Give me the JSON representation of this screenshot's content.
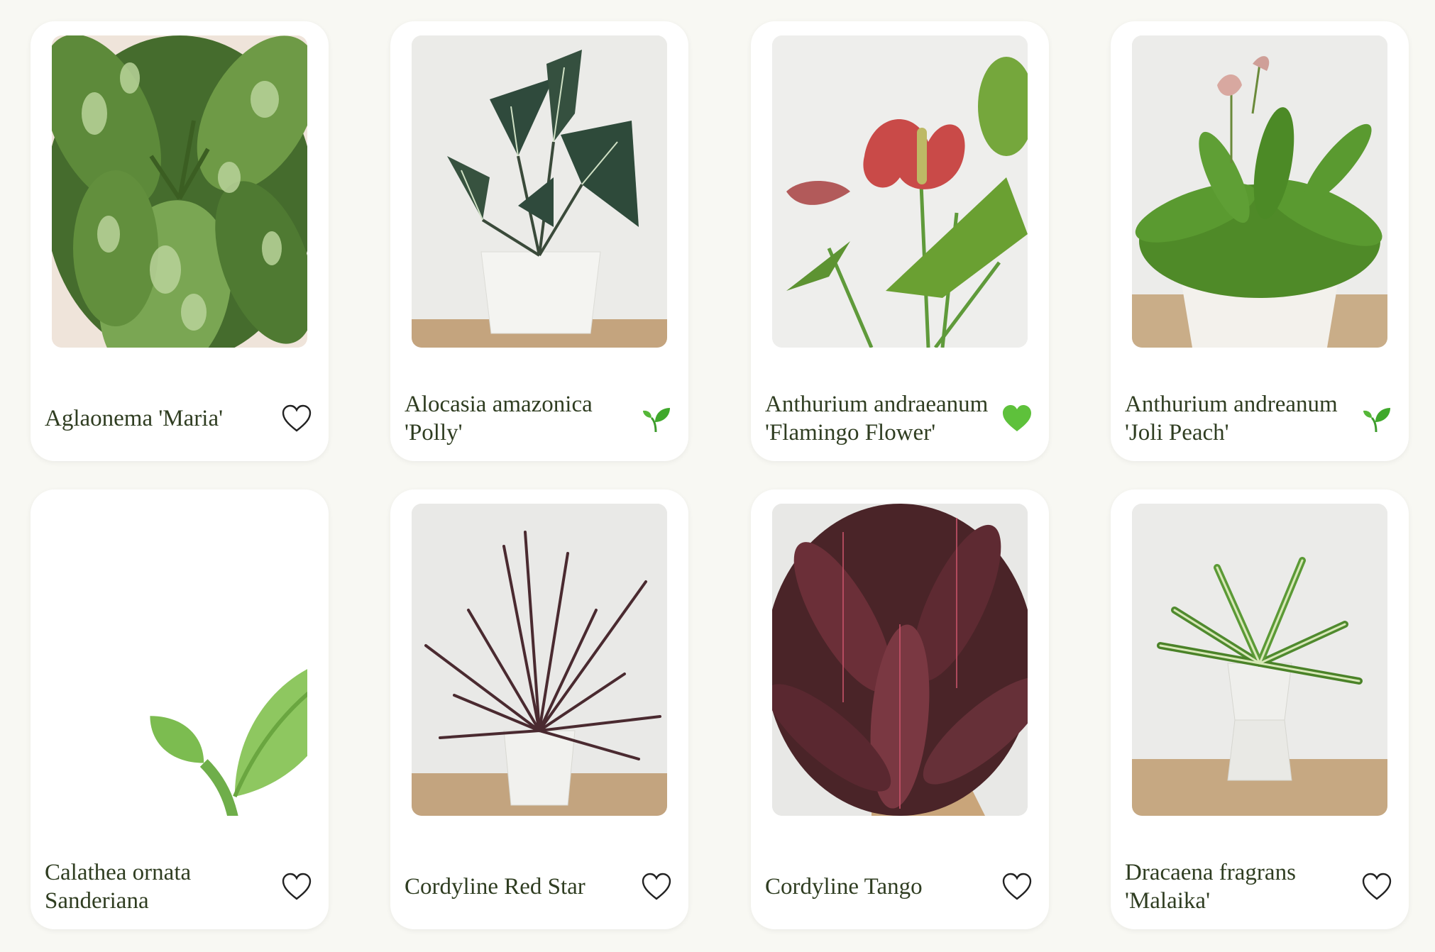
{
  "plants": [
    {
      "name": "Aglaonema 'Maria'",
      "status_icon": "heart-outline-icon"
    },
    {
      "name": "Alocasia amazonica 'Polly'",
      "status_icon": "seedling-icon"
    },
    {
      "name": "Anthurium andraeanum 'Flamingo Flower'",
      "status_icon": "green-heart-icon"
    },
    {
      "name": "Anthurium andreanum 'Joli Peach'",
      "status_icon": "seedling-icon"
    },
    {
      "name": "Calathea ornata Sanderiana",
      "status_icon": "heart-outline-icon"
    },
    {
      "name": "Cordyline Red Star",
      "status_icon": "heart-outline-icon"
    },
    {
      "name": "Cordyline Tango",
      "status_icon": "heart-outline-icon"
    },
    {
      "name": "Dracaena fragrans 'Malaika'",
      "status_icon": "heart-outline-icon"
    }
  ],
  "colors": {
    "page_background": "#f8f8f3",
    "card_background": "#ffffff",
    "text": "#2f3d21",
    "green_heart": "#5ec13b"
  }
}
